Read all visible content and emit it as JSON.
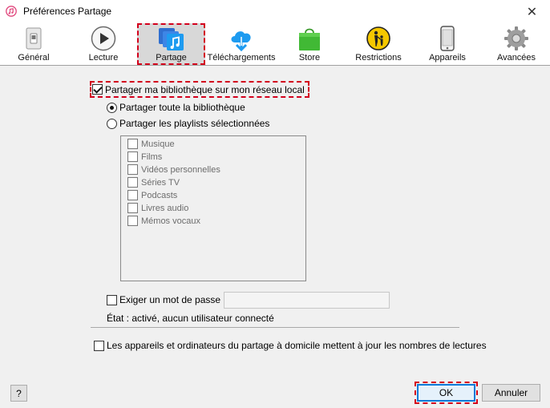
{
  "window": {
    "title": "Préférences Partage",
    "close_glyph": "✕"
  },
  "toolbar": [
    {
      "id": "general",
      "label": "Général",
      "icon": "phone-switch-icon"
    },
    {
      "id": "lecture",
      "label": "Lecture",
      "icon": "play-icon"
    },
    {
      "id": "partage",
      "label": "Partage",
      "icon": "share-music-icon",
      "active": true
    },
    {
      "id": "telechargements",
      "label": "Téléchargements",
      "icon": "cloud-download-icon"
    },
    {
      "id": "store",
      "label": "Store",
      "icon": "shopping-bag-icon"
    },
    {
      "id": "restrictions",
      "label": "Restrictions",
      "icon": "parental-icon"
    },
    {
      "id": "appareils",
      "label": "Appareils",
      "icon": "phone-icon"
    },
    {
      "id": "avancees",
      "label": "Avancées",
      "icon": "gear-icon"
    }
  ],
  "share": {
    "main_checkbox": "Partager ma bibliothèque sur mon réseau local",
    "radio_all": "Partager toute la bibliothèque",
    "radio_selected": "Partager les playlists sélectionnées"
  },
  "playlists": [
    "Musique",
    "Films",
    "Vidéos personnelles",
    "Séries TV",
    "Podcasts",
    "Livres audio",
    "Mémos vocaux"
  ],
  "password": {
    "label": "Exiger un mot de passe :",
    "value": ""
  },
  "status": "État : activé, aucun utilisateur connecté",
  "home_sharing": "Les appareils et ordinateurs du partage à domicile mettent à jour les nombres de lectures",
  "buttons": {
    "help": "?",
    "ok": "OK",
    "cancel": "Annuler"
  },
  "colors": {
    "highlight": "#d3001c",
    "default_button_border": "#0078d7"
  }
}
